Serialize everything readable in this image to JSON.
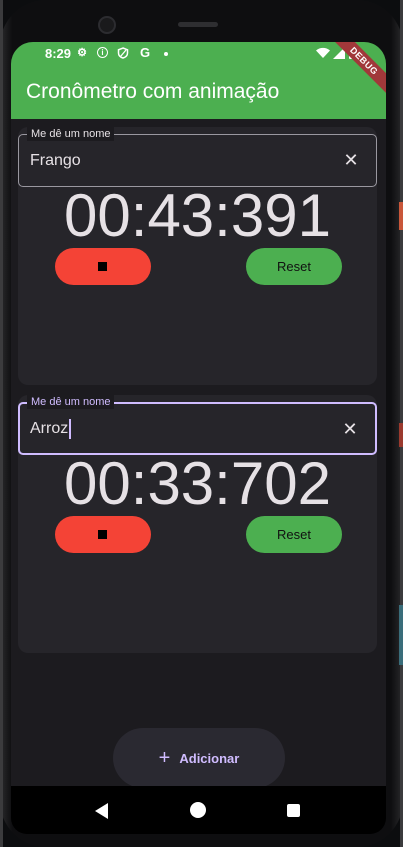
{
  "status_bar": {
    "time": "8:29",
    "icons": [
      "gear-icon",
      "info-icon",
      "shield-icon",
      "google-icon",
      "dot-icon",
      "wifi-icon",
      "signal-icon",
      "battery-icon"
    ]
  },
  "app_bar": {
    "title": "Cronômetro com animação",
    "color": "#4caf50",
    "debug_banner": "DEBUG"
  },
  "stopwatches": [
    {
      "field_label": "Me dê um nome",
      "field_value": "Frango",
      "time": "00:43:391",
      "reset_label": "Reset",
      "focused": false
    },
    {
      "field_label": "Me dê um nome",
      "field_value": "Arroz",
      "time": "00:33:702",
      "reset_label": "Reset",
      "focused": true
    }
  ],
  "fab": {
    "label": "Adicionar"
  },
  "colors": {
    "stop_button": "#f44336",
    "reset_button": "#4caf50",
    "background": "#1c1b1f",
    "accent": "#d0bcff"
  }
}
